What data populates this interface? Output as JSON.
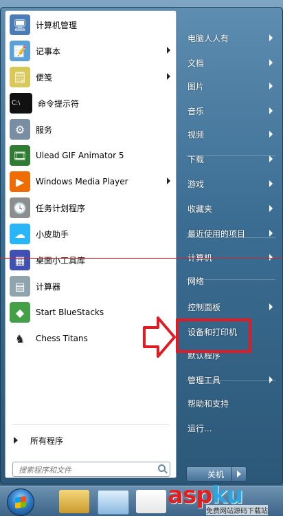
{
  "left_programs": [
    {
      "label": "计算机管理",
      "icon": "computer-management-icon",
      "color": "#4a7db5",
      "glyph": "🖥"
    },
    {
      "label": "记事本",
      "icon": "notepad-icon",
      "color": "#5ca0d8",
      "glyph": "📝",
      "has_submenu": true
    },
    {
      "label": "便笺",
      "icon": "sticky-notes-icon",
      "color": "#d9c95a",
      "glyph": "🗒",
      "has_submenu": true
    },
    {
      "label": "命令提示符",
      "icon": "cmd-icon",
      "color": "#111111",
      "glyph": "C:\\"
    },
    {
      "label": "服务",
      "icon": "services-gear-icon",
      "color": "#7a8ea3",
      "glyph": "⚙"
    },
    {
      "label": "Ulead GIF Animator 5",
      "icon": "ulead-icon",
      "color": "#2e7d32",
      "glyph": "🎞"
    },
    {
      "label": "Windows Media Player",
      "icon": "media-player-icon",
      "color": "#ef6c00",
      "glyph": "▶",
      "has_submenu": true
    },
    {
      "label": "任务计划程序",
      "icon": "task-scheduler-clock-icon",
      "color": "#8d8d8d",
      "glyph": "🕓"
    },
    {
      "label": "小皮助手",
      "icon": "xiaopi-icon",
      "color": "#29b6f6",
      "glyph": "☁"
    },
    {
      "label": "桌面小工具库",
      "icon": "gadgets-icon",
      "color": "#3f51b5",
      "glyph": "▦"
    },
    {
      "label": "计算器",
      "icon": "calculator-icon",
      "color": "#90a4ae",
      "glyph": "▤"
    },
    {
      "label": "Start BlueStacks",
      "icon": "bluestacks-icon",
      "color": "#43a047",
      "glyph": "◆"
    },
    {
      "label": "Chess Titans",
      "icon": "chess-icon",
      "color": "#ffffff",
      "glyph": "♞"
    }
  ],
  "all_programs_label": "所有程序",
  "search_placeholder": "搜索程序和文件",
  "right_items": [
    {
      "label": "电脑人人有",
      "has_submenu": true
    },
    {
      "label": "文档",
      "has_submenu": true
    },
    {
      "label": "图片",
      "has_submenu": true
    },
    {
      "label": "音乐",
      "has_submenu": true
    },
    {
      "label": "视频",
      "has_submenu": true
    },
    {
      "label": "下载",
      "has_submenu": true
    },
    {
      "label": "游戏",
      "has_submenu": true
    },
    {
      "label": "收藏夹",
      "has_submenu": true
    },
    {
      "label": "最近使用的项目",
      "has_submenu": true
    },
    {
      "label": "计算机",
      "has_submenu": true
    },
    {
      "label": "网络",
      "has_submenu": false
    },
    {
      "label": "控制面板",
      "has_submenu": true
    },
    {
      "label": "设备和打印机",
      "has_submenu": false,
      "highlighted": true
    },
    {
      "label": "默认程序",
      "has_submenu": false
    },
    {
      "label": "管理工具",
      "has_submenu": true
    },
    {
      "label": "帮助和支持",
      "has_submenu": false
    },
    {
      "label": "运行...",
      "has_submenu": false
    }
  ],
  "shutdown_label": "关机",
  "watermark": {
    "asp": "asp",
    "ku": "ku",
    "sub": "免费网站源码下载站"
  },
  "colors": {
    "highlight": "#e01b24",
    "menu_blue": "#3b6d93"
  }
}
